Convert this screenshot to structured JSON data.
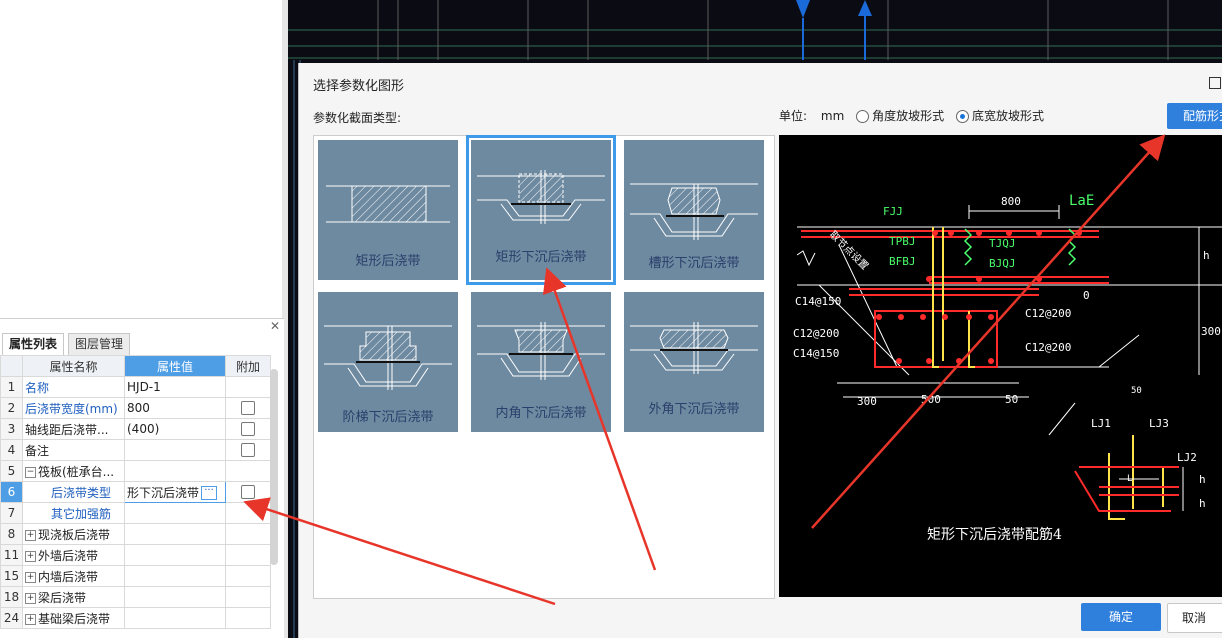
{
  "dialog": {
    "title": "选择参数化图形",
    "section_label": "参数化截面类型:",
    "unit_label": "单位:",
    "unit_value": "mm",
    "slope_options": [
      {
        "label": "角度放坡形式",
        "selected": false
      },
      {
        "label": "底宽放坡形式",
        "selected": true
      }
    ],
    "rebar_button": "配筋形式",
    "ok_button": "确定",
    "cancel_button": "取消",
    "shapes": [
      {
        "label": "矩形后浇带",
        "selected": false
      },
      {
        "label": "矩形下沉后浇带",
        "selected": true
      },
      {
        "label": "槽形下沉后浇带",
        "selected": false
      },
      {
        "label": "阶梯下沉后浇带",
        "selected": false
      },
      {
        "label": "内角下沉后浇带",
        "selected": false
      },
      {
        "label": "外角下沉后浇带",
        "selected": false
      }
    ],
    "preview": {
      "caption": "矩形下沉后浇带配筋4",
      "labels": {
        "fjj": "FJJ",
        "dim_800": "800",
        "lae": "LaE",
        "tpbj": "TPBJ",
        "tjqj": "TJQJ",
        "bfbj": "BFBJ",
        "bjqj": "BJQJ",
        "h": "h",
        "zero": "0",
        "diag_text": "取节点设置",
        "c14_150_a": "C14@150",
        "c12_200_a": "C12@200",
        "c14_150_b": "C14@150",
        "c12_200_r1": "C12@200",
        "c12_200_r2": "C12@200",
        "dim_300_r": "300",
        "dim_300_b": "300",
        "dim_500": "500",
        "dim_50": "50",
        "lj1": "LJ1",
        "lj3": "LJ3",
        "lj2": "LJ2",
        "dim_50_b": "50",
        "l": "L",
        "h2": "h",
        "h3": "h"
      }
    }
  },
  "properties": {
    "tabs": [
      "属性列表",
      "图层管理"
    ],
    "headers": [
      "属性名称",
      "属性值",
      "附加"
    ],
    "rows": [
      {
        "idx": "1",
        "name": "名称",
        "value": "HJD-1",
        "blue": true,
        "check": false,
        "tree": ""
      },
      {
        "idx": "2",
        "name": "后浇带宽度(mm)",
        "value": "800",
        "blue": true,
        "check": true,
        "tree": ""
      },
      {
        "idx": "3",
        "name": "轴线距后浇带...",
        "value": "(400)",
        "blue": false,
        "check": true,
        "tree": ""
      },
      {
        "idx": "4",
        "name": "备注",
        "value": "",
        "blue": false,
        "check": true,
        "tree": ""
      },
      {
        "idx": "5",
        "name": "筏板(桩承台...",
        "value": "",
        "blue": false,
        "check": false,
        "tree": "−"
      },
      {
        "idx": "6",
        "name": "后浇带类型",
        "value": "形下沉后浇带",
        "blue": true,
        "check": true,
        "tree": "",
        "selected": true
      },
      {
        "idx": "7",
        "name": "其它加强筋",
        "value": "",
        "blue": true,
        "check": false,
        "tree": ""
      },
      {
        "idx": "8",
        "name": "现浇板后浇带",
        "value": "",
        "blue": false,
        "check": false,
        "tree": "+"
      },
      {
        "idx": "11",
        "name": "外墙后浇带",
        "value": "",
        "blue": false,
        "check": false,
        "tree": "+"
      },
      {
        "idx": "15",
        "name": "内墙后浇带",
        "value": "",
        "blue": false,
        "check": false,
        "tree": "+"
      },
      {
        "idx": "18",
        "name": "梁后浇带",
        "value": "",
        "blue": false,
        "check": false,
        "tree": "+"
      },
      {
        "idx": "24",
        "name": "基础梁后浇带",
        "value": "",
        "blue": false,
        "check": false,
        "tree": "+"
      }
    ]
  },
  "colors": {
    "accent": "#2f7fdd",
    "thumb_bg": "#6e8aa1",
    "annotation_arrow": "#e8352a"
  }
}
